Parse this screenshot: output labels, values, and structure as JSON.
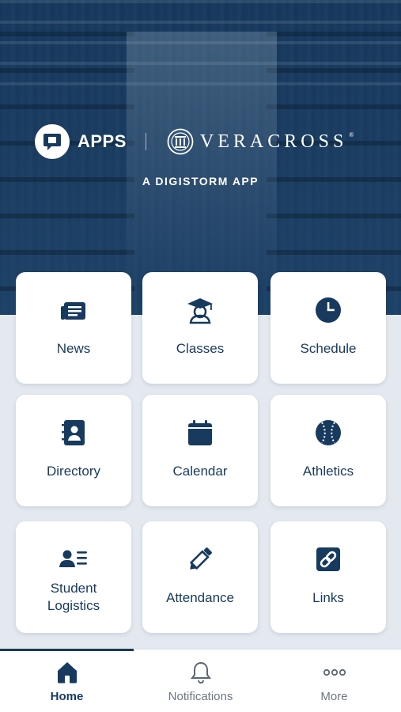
{
  "header": {
    "apps_label": "APPS",
    "veracross_label": "VERACROSS",
    "veracross_reg": "®",
    "tagline": "A DIGISTORM APP"
  },
  "tiles": [
    {
      "label": "News",
      "icon": "newspaper-icon"
    },
    {
      "label": "Classes",
      "icon": "graduation-cap-icon"
    },
    {
      "label": "Schedule",
      "icon": "clock-icon"
    },
    {
      "label": "Directory",
      "icon": "address-book-icon"
    },
    {
      "label": "Calendar",
      "icon": "calendar-icon"
    },
    {
      "label": "Athletics",
      "icon": "baseball-icon"
    },
    {
      "label": "Student\nLogistics",
      "line1": "Student",
      "line2": "Logistics",
      "icon": "user-list-icon"
    },
    {
      "label": "Attendance",
      "icon": "pencil-icon"
    },
    {
      "label": "Links",
      "icon": "link-icon"
    }
  ],
  "tabbar": {
    "items": [
      {
        "label": "Home",
        "icon": "home-icon",
        "active": true
      },
      {
        "label": "Notifications",
        "icon": "bell-icon",
        "active": false
      },
      {
        "label": "More",
        "icon": "more-dots-icon",
        "active": false
      }
    ]
  },
  "colors": {
    "primary": "#173a5e",
    "background": "#e4e9f0",
    "tile": "#ffffff",
    "inactive_tab": "#6b7785"
  }
}
